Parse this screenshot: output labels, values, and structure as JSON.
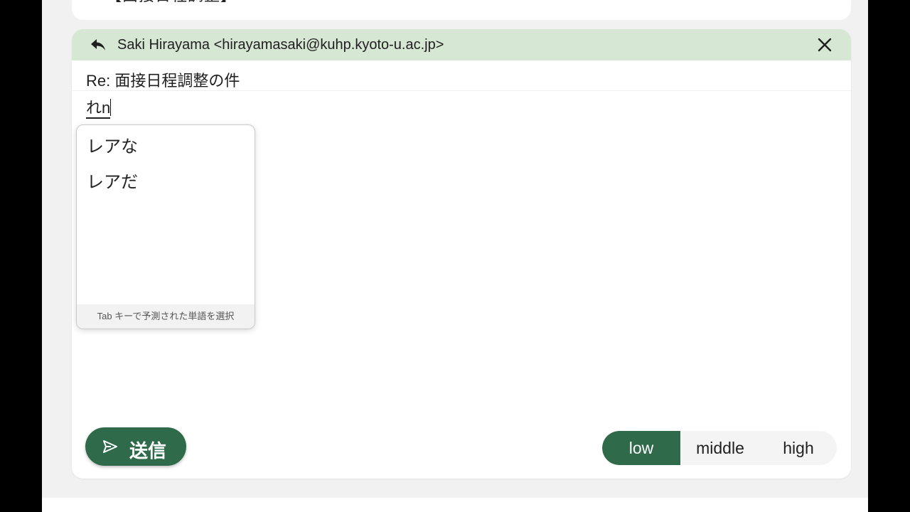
{
  "previous_message": {
    "text": "【面接日程調整】"
  },
  "reply": {
    "recipient": "Saki Hirayama <hirayamasaki@kuhp.kyoto-u.ac.jp>",
    "subject": "Re: 面接日程調整の件",
    "body_composing_text": "れn",
    "icons": {
      "reply": "reply-arrow-icon",
      "close": "close-icon",
      "send": "send-icon"
    }
  },
  "ime_suggestions": {
    "candidates": [
      "レアな",
      "レアだ"
    ],
    "footer_hint": "Tab キーで予測された単語を選択"
  },
  "actions": {
    "send_label": "送信"
  },
  "level_selector": {
    "options": [
      "low",
      "middle",
      "high"
    ],
    "selected": "low"
  },
  "colors": {
    "accent_green": "#2f6a4a",
    "header_green": "#d6e8d3"
  }
}
